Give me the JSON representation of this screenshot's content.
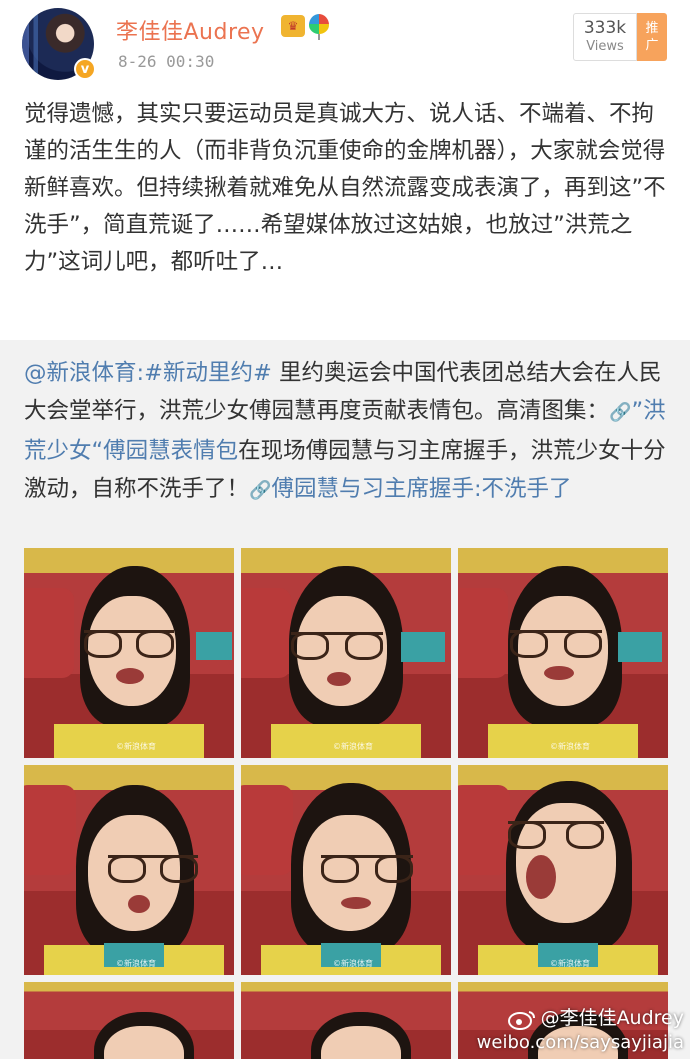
{
  "header": {
    "username": "李佳佳Audrey",
    "timestamp": "8-26 00:30",
    "views_count": "333k",
    "views_label": "Views",
    "promote_label_1": "推",
    "promote_label_2": "广",
    "verified_mark": "v",
    "crown_icon": "crown-icon",
    "balloon_icon": "balloon-icon"
  },
  "post": {
    "text": "觉得遗憾，其实只要运动员是真诚大方、说人话、不端着、不拘谨的活生生的人（而非背负沉重使命的金牌机器），大家就会觉得新鲜喜欢。但持续揪着就难免从自然流露变成表演了，再到这”不洗手”，简直荒诞了……希望媒体放过这姑娘，也放过”洪荒之力”这词儿吧，都听吐了…"
  },
  "repost": {
    "mention": "@新浪体育",
    "colon": ":",
    "hashtag": "#新动里约#",
    "text_1": " 里约奥运会中国代表团总结大会在人民大会堂举行，洪荒少女傅园慧再度贡献表情包。高清图集：",
    "link_1": "”洪荒少女“傅园慧表情包",
    "text_2": "在现场傅园慧与习主席握手，洪荒少女十分激动，自称不洗手了！",
    "link_2": "傅园慧与习主席握手:不洗手了"
  },
  "photos": {
    "watermark_small": "©新浪体育"
  },
  "watermark": {
    "handle": "@李佳佳Audrey",
    "url": "weibo.com/saysayjiajia"
  },
  "colors": {
    "username": "#eb7350",
    "link": "#507daf",
    "promote": "#f7a35c",
    "repost_bg": "#f2f2f2"
  }
}
